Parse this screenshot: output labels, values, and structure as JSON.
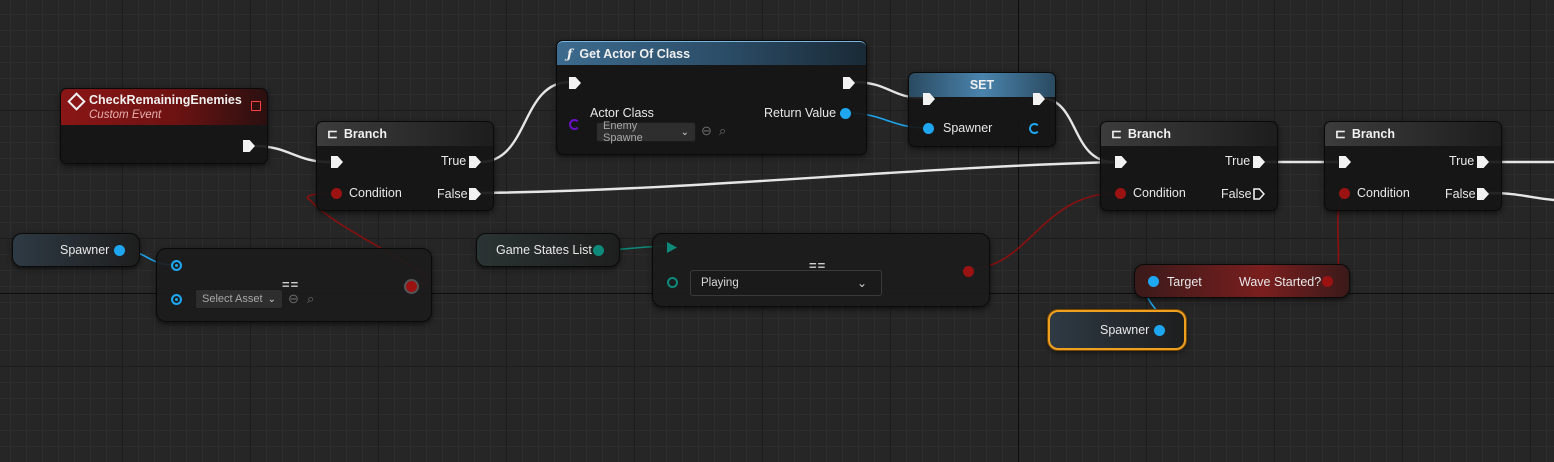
{
  "event_node": {
    "title": "CheckRemainingEnemies",
    "subtitle": "Custom Event"
  },
  "branch1": {
    "title": "Branch",
    "true_label": "True",
    "false_label": "False",
    "condition_label": "Condition"
  },
  "get_actor": {
    "title": "Get Actor Of Class",
    "actor_class_label": "Actor Class",
    "actor_class_value": "Enemy Spawne",
    "return_label": "Return Value"
  },
  "set_node": {
    "title": "SET",
    "var_label": "Spawner"
  },
  "branch2": {
    "title": "Branch",
    "true_label": "True",
    "false_label": "False",
    "condition_label": "Condition"
  },
  "branch3": {
    "title": "Branch",
    "true_label": "True",
    "false_label": "False",
    "condition_label": "Condition"
  },
  "spawner_getter_left": {
    "label": "Spawner"
  },
  "equal_node1": {
    "symbol": "==",
    "select_asset": "Select Asset"
  },
  "game_states": {
    "label": "Game States List"
  },
  "equal_node2": {
    "symbol": "==",
    "selected_value": "Playing"
  },
  "wave_started": {
    "target_label": "Target",
    "output_label": "Wave Started?"
  },
  "spawner_getter_selected": {
    "label": "Spawner"
  },
  "icons": {
    "event": "event-diamond-icon",
    "branch": "branch-icon",
    "function": "function-f-icon",
    "reset": "reset-arrow-icon",
    "browse": "magnifier-icon",
    "stop": "red-square-icon"
  },
  "colors": {
    "exec": "#f2f2f2",
    "object_pin": "#1ea7f0",
    "bool_pin": "#9a1212",
    "enum_pin": "#0d8a7a",
    "class_pin": "#6a10c8",
    "selection": "#f0a020"
  }
}
